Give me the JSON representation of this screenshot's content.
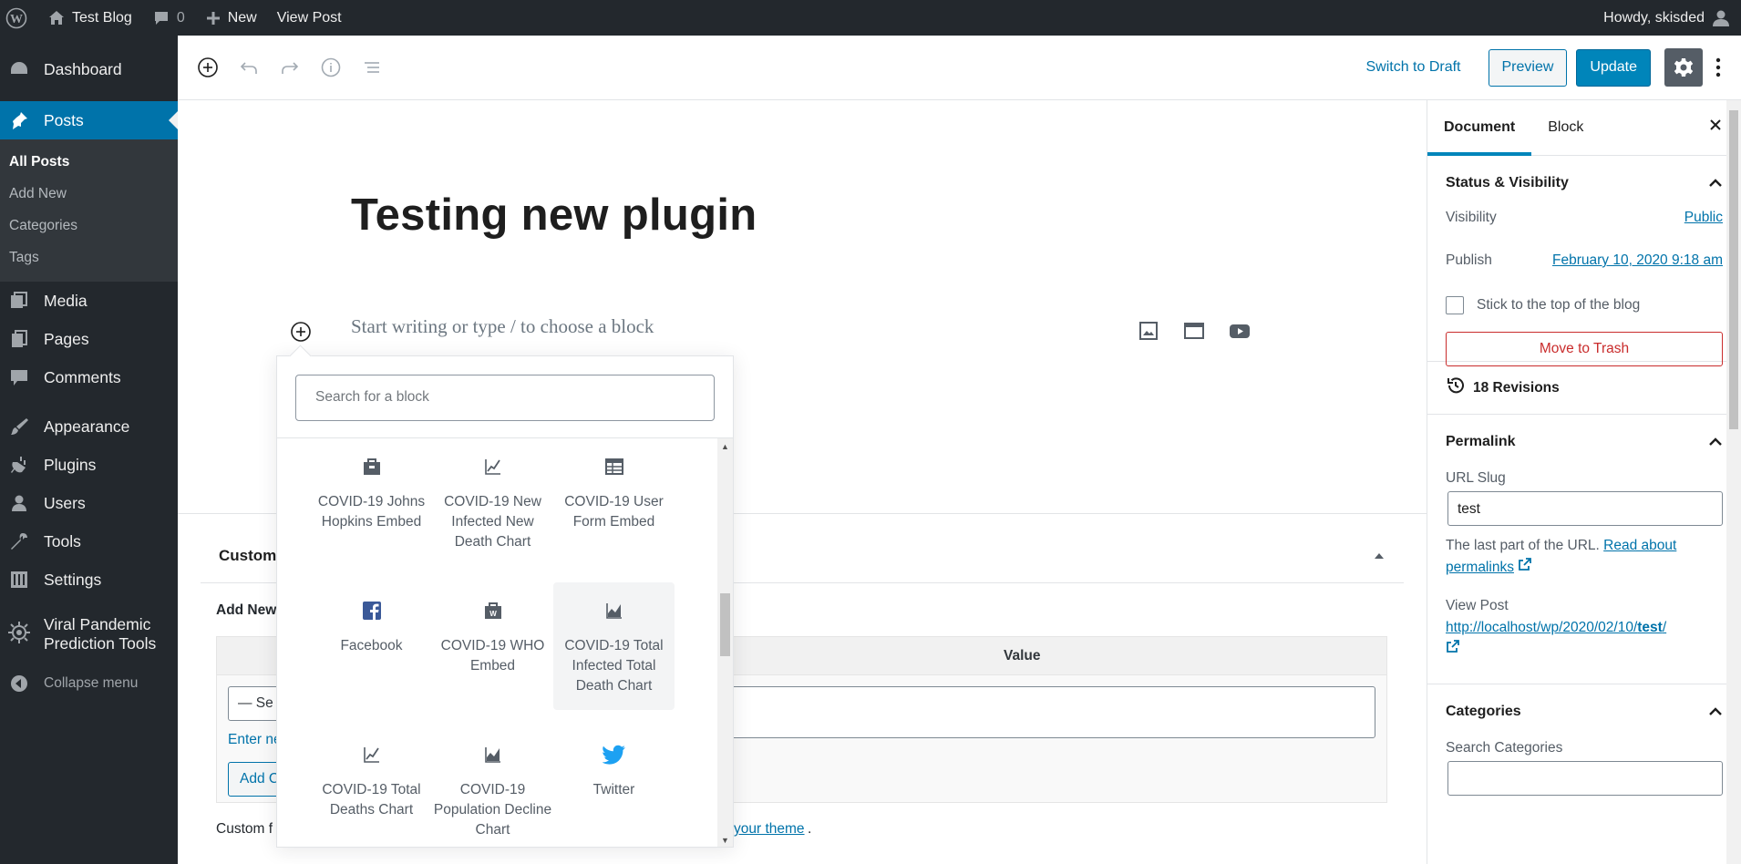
{
  "adminbar": {
    "site_name": "Test Blog",
    "comments_count": "0",
    "new_label": "New",
    "view_post": "View Post",
    "howdy": "Howdy, skisded"
  },
  "adminmenu": {
    "dashboard": "Dashboard",
    "posts": "Posts",
    "posts_sub": [
      "All Posts",
      "Add New",
      "Categories",
      "Tags"
    ],
    "media": "Media",
    "pages": "Pages",
    "comments": "Comments",
    "appearance": "Appearance",
    "plugins": "Plugins",
    "users": "Users",
    "tools": "Tools",
    "settings": "Settings",
    "viral_line1": "Viral Pandemic",
    "viral_line2": "Prediction Tools",
    "collapse": "Collapse menu"
  },
  "header": {
    "switch_to_draft": "Switch to Draft",
    "preview": "Preview",
    "update": "Update"
  },
  "editor": {
    "post_title": "Testing new plugin",
    "placeholder": "Start writing or type / to choose a block"
  },
  "metabox": {
    "title": "Custom",
    "add_new": "Add New",
    "value_header": "Value",
    "select_value": "— Se",
    "enter_new": "Enter ne",
    "add_button": "Add C",
    "note": "Custom f",
    "note_link": "your theme",
    "note_end": "."
  },
  "inserter": {
    "search_placeholder": "Search for a block",
    "blocks": [
      {
        "label": "COVID-19 Johns Hopkins Embed",
        "icon": "briefcase-icon"
      },
      {
        "label": "COVID-19 New Infected New Death Chart",
        "icon": "chart-line-icon"
      },
      {
        "label": "COVID-19 User Form Embed",
        "icon": "table-icon"
      },
      {
        "label": "Facebook",
        "icon": "facebook-icon"
      },
      {
        "label": "COVID-19 WHO Embed",
        "icon": "who-briefcase-icon"
      },
      {
        "label": "COVID-19 Total Infected Total Death Chart",
        "icon": "chart-area-icon"
      },
      {
        "label": "COVID-19 Total Deaths Chart",
        "icon": "chart-line-icon"
      },
      {
        "label": "COVID-19 Population Decline Chart",
        "icon": "chart-area-icon"
      },
      {
        "label": "Twitter",
        "icon": "twitter-icon"
      }
    ]
  },
  "sidebar": {
    "tab_document": "Document",
    "tab_block": "Block",
    "status_title": "Status & Visibility",
    "visibility_label": "Visibility",
    "visibility_value": "Public",
    "publish_label": "Publish",
    "publish_value": "February 10, 2020 9:18 am",
    "sticky_label": "Stick to the top of the blog",
    "trash": "Move to Trash",
    "revisions": "18 Revisions",
    "permalink_title": "Permalink",
    "url_slug_label": "URL Slug",
    "url_slug_value": "test",
    "permalink_help": "The last part of the URL.",
    "permalink_help_link1": "Read about",
    "permalink_help_link2": "permalinks",
    "view_post_label": "View Post",
    "view_post_url_prefix": "http://localhost/wp/2020/02/10/",
    "view_post_url_slug": "test",
    "view_post_url_suffix": "/",
    "categories_title": "Categories",
    "search_categories": "Search Categories"
  },
  "colors": {
    "admin_dark": "#23282d",
    "accent": "#0073aa",
    "primary_button": "#0085ba",
    "trash": "#c92c2c"
  }
}
